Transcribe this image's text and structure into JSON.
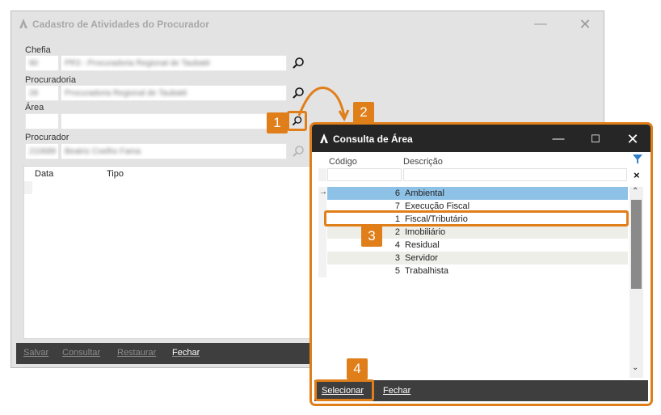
{
  "main_window": {
    "title": "Cadastro de Atividades do Procurador",
    "labels": {
      "chefia": "Chefia",
      "procuradoria": "Procuradoria",
      "area": "Área",
      "procurador": "Procurador"
    },
    "fields": {
      "chefia_code": "90",
      "chefia_name": "PR3 - Procuradoria Regional de Taubaté",
      "procuradoria_code": "28",
      "procuradoria_name": "Procuradoria Regional de Taubaté",
      "area_code": "",
      "area_name": "",
      "procurador_code": "210689",
      "procurador_name": "Beatriz Coelho Fama"
    },
    "grid_columns": [
      "Data",
      "Tipo"
    ],
    "footer_buttons": {
      "salvar": "Salvar",
      "consultar": "Consultar",
      "restaurar": "Restaurar",
      "fechar": "Fechar"
    }
  },
  "dialog": {
    "title": "Consulta de Área",
    "columns": {
      "codigo": "Código",
      "descricao": "Descrição"
    },
    "rows": [
      {
        "codigo": "6",
        "descricao": "Ambiental"
      },
      {
        "codigo": "7",
        "descricao": "Execução Fiscal"
      },
      {
        "codigo": "1",
        "descricao": "Fiscal/Tributário"
      },
      {
        "codigo": "2",
        "descricao": "Imobiliário"
      },
      {
        "codigo": "4",
        "descricao": "Residual"
      },
      {
        "codigo": "3",
        "descricao": "Servidor"
      },
      {
        "codigo": "5",
        "descricao": "Trabalhista"
      }
    ],
    "footer_buttons": {
      "selecionar": "Selecionar",
      "fechar": "Fechar"
    }
  },
  "callouts": [
    "1",
    "2",
    "3",
    "4"
  ],
  "colors": {
    "accent_orange": "#e07f1a",
    "selected_row": "#8ec1e6",
    "dialog_titlebar": "#262626",
    "footer_bar": "#3e3e3e"
  },
  "icons": [
    "app-logo-icon",
    "minimize-icon",
    "maximize-icon",
    "close-icon",
    "search-icon",
    "filter-icon",
    "clear-filter-icon",
    "row-pointer-icon",
    "scroll-up-icon",
    "scroll-down-icon"
  ]
}
